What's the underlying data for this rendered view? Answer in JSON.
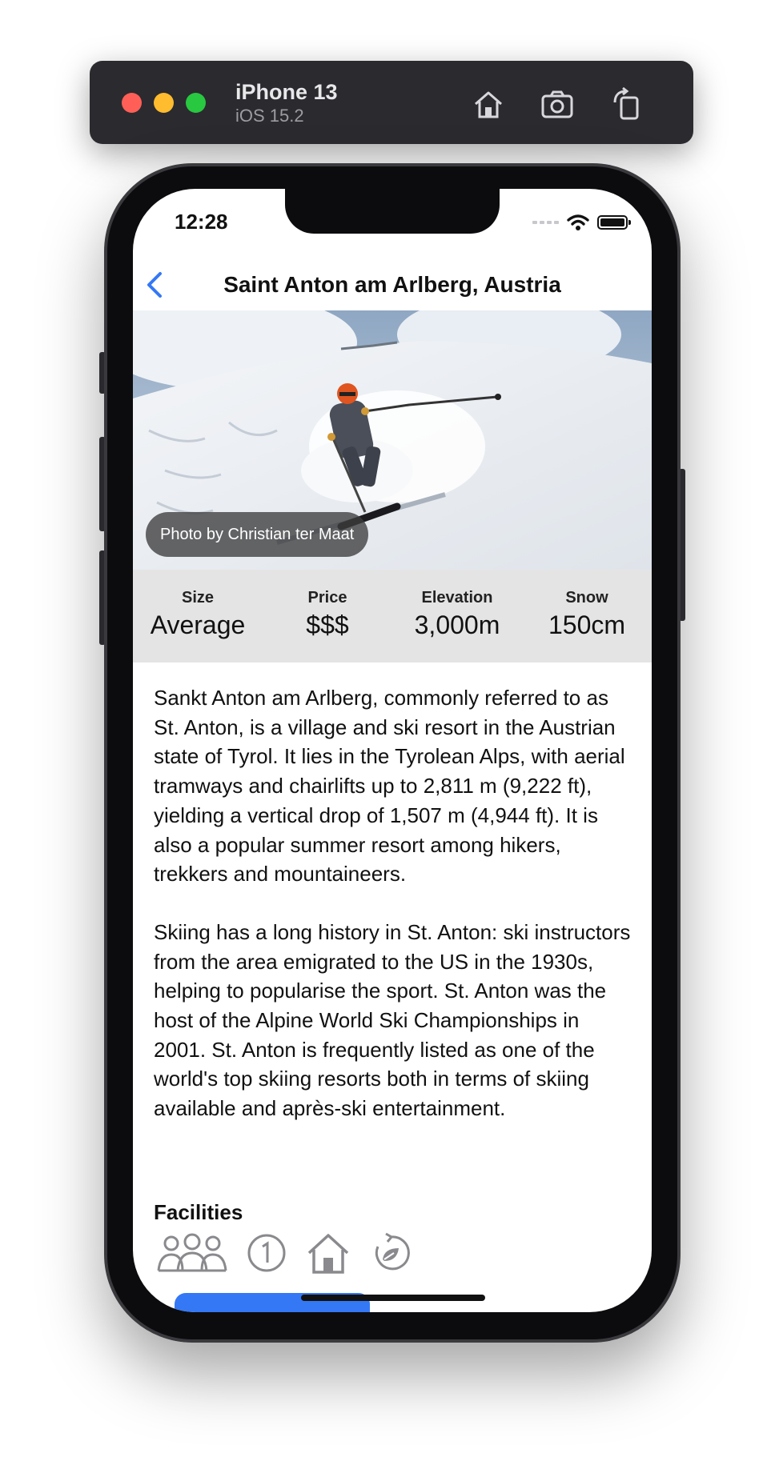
{
  "simulator": {
    "device": "iPhone 13",
    "os": "iOS 15.2",
    "buttons": [
      "home-icon",
      "screenshot-icon",
      "rotate-icon"
    ]
  },
  "status_bar": {
    "time": "12:28"
  },
  "nav": {
    "title": "Saint Anton am Arlberg, Austria",
    "back_icon": "chevron-left-icon"
  },
  "hero": {
    "credit": "Photo by Christian ter Maat"
  },
  "stats": [
    {
      "label": "Size",
      "value": "Average"
    },
    {
      "label": "Price",
      "value": "$$$"
    },
    {
      "label": "Elevation",
      "value": "3,000m"
    },
    {
      "label": "Snow",
      "value": "150cm"
    }
  ],
  "description": [
    "Sankt Anton am Arlberg, commonly referred to as St. Anton, is a village and ski resort in the Austrian state of Tyrol. It lies in the Tyrolean Alps, with aerial tramways and chairlifts up to 2,811 m (9,222 ft), yielding a vertical drop of 1,507 m (4,944 ft). It is also a popular summer resort among hikers, trekkers and mountaineers.",
    "Skiing has a long history in St. Anton: ski instructors from the area emigrated to the US in the 1930s, helping to popularise the sport. St. Anton was the host of the Alpine World Ski Championships in 2001. St. Anton is frequently listed as one of the world's top skiing resorts both in terms of skiing available and après-ski entertainment."
  ],
  "facilities": {
    "title": "Facilities",
    "icons": [
      "family-icon",
      "beginner-icon",
      "accommodation-icon",
      "eco-icon"
    ]
  },
  "colors": {
    "accent": "#3478f6",
    "stats_bg": "#e4e4e4"
  }
}
